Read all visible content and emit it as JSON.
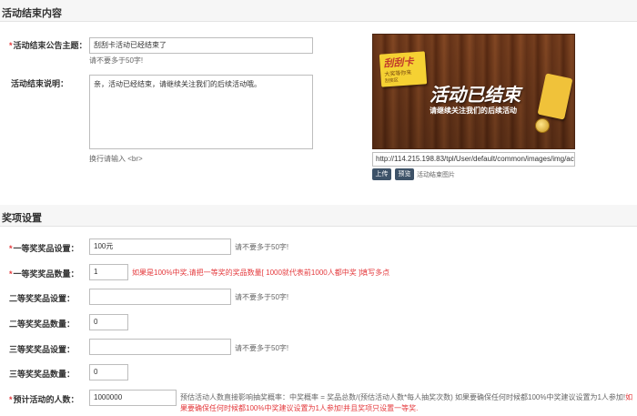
{
  "section1": {
    "title": "活动结束内容",
    "announce_label": "活动结束公告主题：",
    "announce_value": "刮刮卡活动已经结束了",
    "announce_hint": "请不要多于50字!",
    "desc_label": "活动结束说明：",
    "desc_value": "亲，活动已经结束，请继续关注我们的后续活动哦。",
    "desc_hint": "换行请输入 <br>",
    "preview": {
      "tag_title": "刮刮卡",
      "tag_sub": "大奖等你来",
      "tag_corner": "刮奖区",
      "main_text": "活动已结束",
      "sub_text": "请继续关注我们的后续活动"
    },
    "image_url": "http://114.215.198.83/tpl/User/default/common/images/img/activity-scratch-card-end.jpg",
    "upload_label": "上传",
    "preview_label": "预览",
    "image_caption": "活动结束图片"
  },
  "section2": {
    "title": "奖项设置",
    "prize1_name_label": "一等奖奖品设置：",
    "prize1_name_value": "100元",
    "prize1_name_hint": "请不要多于50字!",
    "prize1_count_label": "一等奖奖品数量：",
    "prize1_count_value": "1",
    "prize1_count_hint": "如果是100%中奖,请把一等奖的奖品数量[ 1000就代表前1000人都中奖 ]填写多点",
    "prize2_name_label": "二等奖奖品设置：",
    "prize2_name_value": "",
    "prize2_name_hint": "请不要多于50字!",
    "prize2_count_label": "二等奖奖品数量：",
    "prize2_count_value": "0",
    "prize3_name_label": "三等奖奖品设置：",
    "prize3_name_value": "",
    "prize3_name_hint": "请不要多于50字!",
    "prize3_count_label": "三等奖奖品数量：",
    "prize3_count_value": "0",
    "people_label": "预计活动的人数：",
    "people_value": "1000000",
    "people_hint_normal": "预估活动人数直接影响抽奖概率：中奖概率 = 奖品总数/(预估活动人数*每人抽奖次数) 如果要确保任何时候都100%中奖建议设置为1人参加!",
    "people_hint_red": "如果要确保任何时候都100%中奖建议设置为1人参加!并且奖项只设置一等奖."
  },
  "colors": {
    "required": "#e4393c",
    "button": "#3d5268"
  }
}
